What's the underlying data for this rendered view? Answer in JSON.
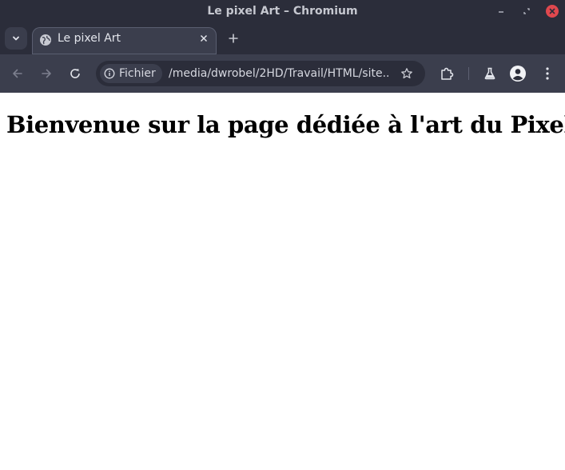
{
  "window": {
    "title": "Le pixel Art – Chromium"
  },
  "tabs": [
    {
      "label": "Le pixel Art",
      "active": true
    }
  ],
  "toolbar": {
    "site_chip_label": "Fichier",
    "url": "/media/dwrobel/2HD/Travail/HTML/site..."
  },
  "page": {
    "heading": "Bienvenue sur la page dédiée à l'art du Pixel"
  },
  "colors": {
    "titlebar_bg": "#2b2d3a",
    "toolbar_bg": "#3b3e4d",
    "close_button": "#e0484e",
    "page_bg": "#ffffff"
  },
  "icons": {
    "tab_search": "chevron-down-icon",
    "favicon": "globe-icon",
    "tab_close": "close-icon",
    "new_tab": "plus-icon",
    "back": "arrow-left-icon",
    "forward": "arrow-right-icon",
    "reload": "reload-icon",
    "site_info": "info-icon",
    "bookmark": "star-icon",
    "extensions": "puzzle-icon",
    "labs": "flask-icon",
    "profile": "avatar-icon",
    "menu": "kebab-menu-icon"
  }
}
